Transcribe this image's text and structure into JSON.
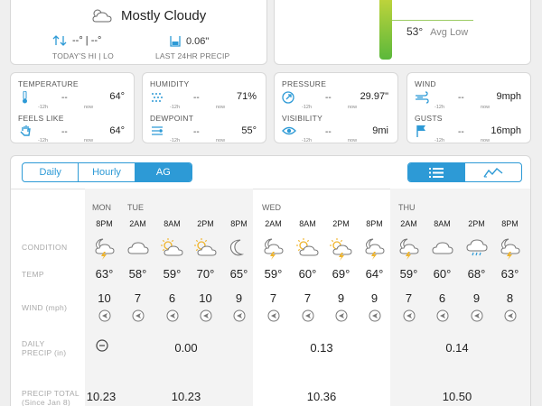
{
  "current": {
    "condition": "Mostly Cloudy",
    "hi_lo": "--° | --°",
    "hi_lo_caption": "TODAY'S HI | LO",
    "precip": "0.06\"",
    "precip_caption": "LAST 24HR PRECIP",
    "avg_low_value": "53°",
    "avg_low_label": "Avg Low"
  },
  "stats": {
    "temperature": {
      "label": "TEMPERATURE",
      "past": "--",
      "now": "64°"
    },
    "feels_like": {
      "label": "FEELS LIKE",
      "past": "--",
      "now": "64°"
    },
    "humidity": {
      "label": "HUMIDITY",
      "past": "--",
      "now": "71%"
    },
    "dewpoint": {
      "label": "DEWPOINT",
      "past": "--",
      "now": "55°"
    },
    "pressure": {
      "label": "PRESSURE",
      "past": "--",
      "now": "29.97\""
    },
    "visibility": {
      "label": "VISIBILITY",
      "past": "--",
      "now": "9mi"
    },
    "wind": {
      "label": "WIND",
      "past": "--",
      "now": "9mph"
    },
    "gusts": {
      "label": "GUSTS",
      "past": "--",
      "now": "16mph"
    },
    "sub_past": "-12h",
    "sub_now": "now"
  },
  "tabs": [
    "Daily",
    "Hourly",
    "AG"
  ],
  "active_tab": "AG",
  "row_labels": {
    "condition": "CONDITION",
    "temp": "TEMP",
    "wind": "WIND (mph)",
    "daily_precip_1": "DAILY",
    "daily_precip_2": "PRECIP (in)",
    "precip_total_1": "PRECIP TOTAL",
    "precip_total_2": "(Since Jan 8)"
  },
  "days": [
    "MON",
    "TUE",
    "WED",
    "THU"
  ],
  "hours": [
    {
      "time": "8PM",
      "icon": "night-storm",
      "temp": "63°",
      "wind": "10"
    },
    {
      "time": "2AM",
      "icon": "cloudy",
      "temp": "58°",
      "wind": "7"
    },
    {
      "time": "8AM",
      "icon": "partly-sunny",
      "temp": "59°",
      "wind": "6"
    },
    {
      "time": "2PM",
      "icon": "partly-sunny",
      "temp": "70°",
      "wind": "10"
    },
    {
      "time": "8PM",
      "icon": "moon",
      "temp": "65°",
      "wind": "9"
    },
    {
      "time": "2AM",
      "icon": "night-storm",
      "temp": "59°",
      "wind": "7"
    },
    {
      "time": "8AM",
      "icon": "partly-sunny",
      "temp": "60°",
      "wind": "7"
    },
    {
      "time": "2PM",
      "icon": "sun-storm",
      "temp": "69°",
      "wind": "9"
    },
    {
      "time": "8PM",
      "icon": "night-storm",
      "temp": "64°",
      "wind": "9"
    },
    {
      "time": "2AM",
      "icon": "night-storm",
      "temp": "59°",
      "wind": "7"
    },
    {
      "time": "8AM",
      "icon": "cloudy",
      "temp": "60°",
      "wind": "6"
    },
    {
      "time": "2PM",
      "icon": "rain",
      "temp": "68°",
      "wind": "9"
    },
    {
      "time": "8PM",
      "icon": "night-storm",
      "temp": "63°",
      "wind": "8"
    }
  ],
  "daily_precip": {
    "mon": "",
    "tue": "0.00",
    "wed": "0.13",
    "thu": "0.14"
  },
  "precip_total": {
    "mon": "10.23",
    "tue": "10.23",
    "wed": "10.36",
    "thu": "10.50"
  },
  "colors": {
    "accent": "#2d9ad6",
    "temp_bar": "#5bb83b"
  }
}
